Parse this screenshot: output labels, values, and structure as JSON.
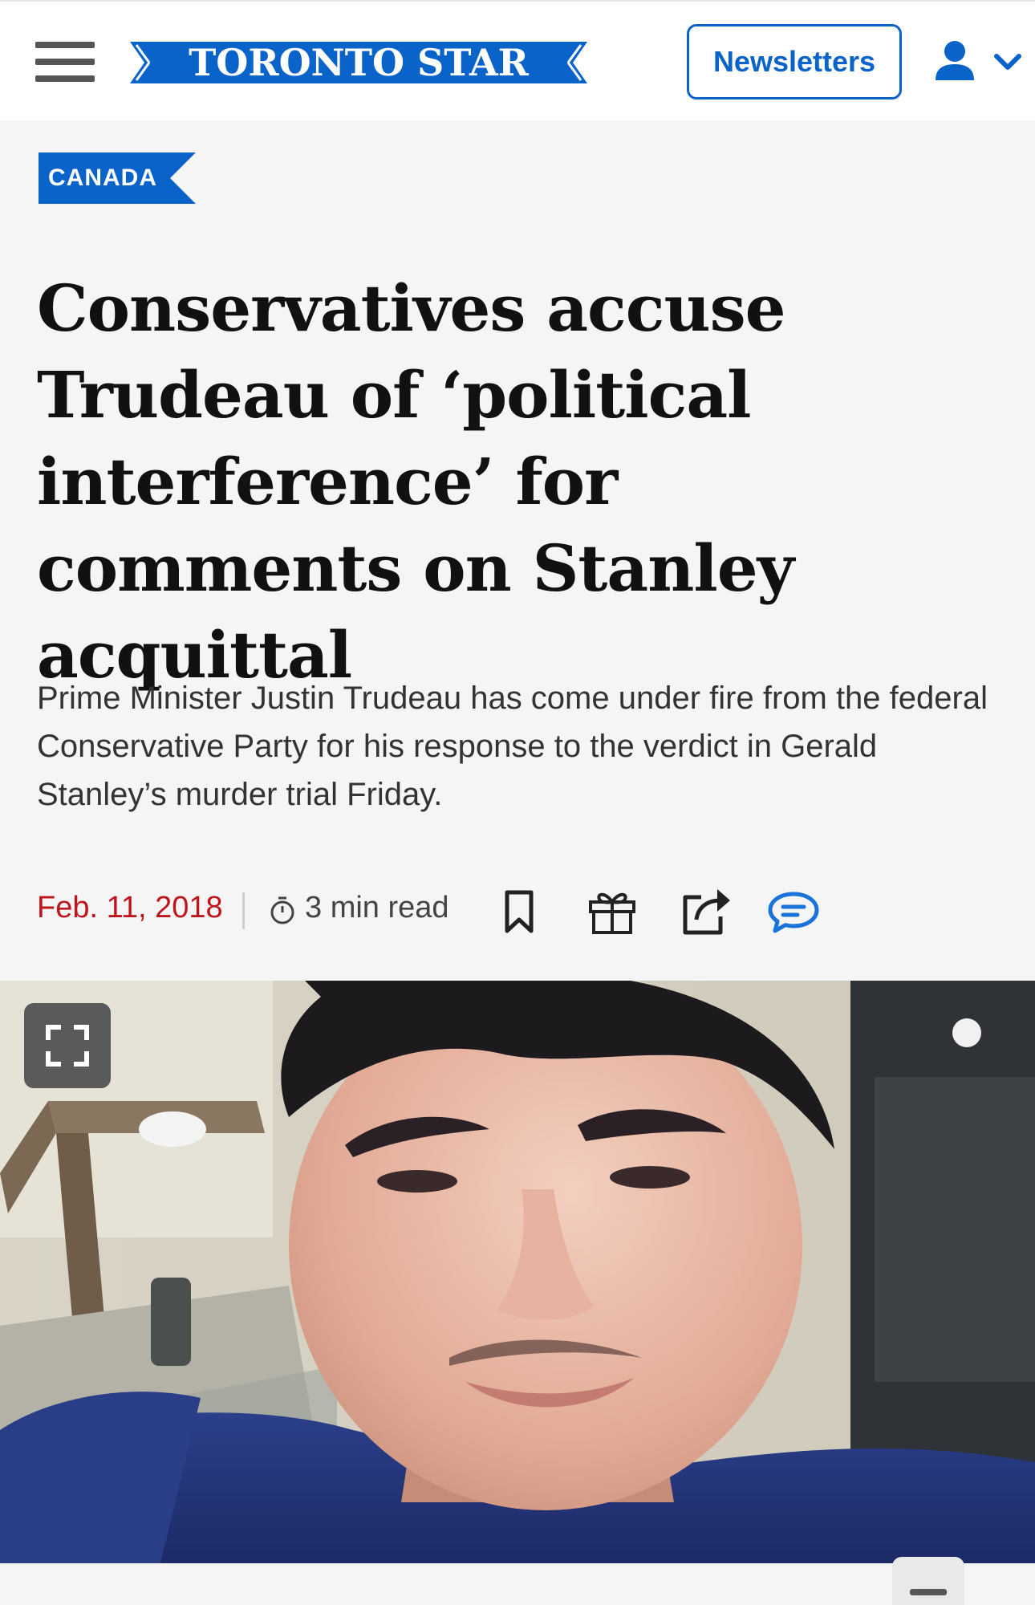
{
  "header": {
    "logo_text": "TORONTO STAR",
    "newsletters_label": "Newsletters",
    "icons": {
      "menu": "hamburger-menu-icon",
      "account": "user-icon",
      "account_dropdown": "chevron-down-icon"
    }
  },
  "article": {
    "section": "CANADA",
    "headline": "Conservatives accuse Trudeau of ‘political interference’ for comments on Stanley acquittal",
    "deck": "Prime Minister Justin Trudeau has come under fire from the federal Conservative Party for his response to the verdict in Gerald Stanley’s murder trial Friday.",
    "date": "Feb. 11, 2018",
    "read_time": "3 min read",
    "actions": [
      "bookmark-icon",
      "gift-icon",
      "share-icon",
      "comment-icon"
    ]
  },
  "colors": {
    "brand_blue": "#0a63c9",
    "date_red": "#c0141c",
    "comment_blue": "#1a73d9"
  }
}
